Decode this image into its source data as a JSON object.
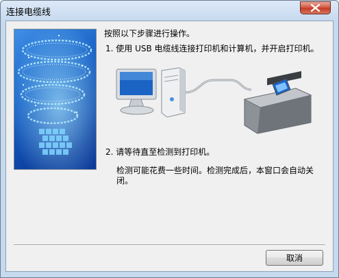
{
  "window": {
    "title": "连接电缆线"
  },
  "instructions": {
    "intro": "按照以下步骤进行操作。",
    "step1": "1. 使用 USB 电缆线连接打印机和计算机，并开启打印机。",
    "step2": "2. 请等待直至检测到打印机。",
    "note_line1": "检测可能花费一些时间。检测完成后，本窗口会自动关",
    "note_line2": "闭。"
  },
  "buttons": {
    "cancel": "取消"
  },
  "icons": {
    "close": "close-icon",
    "computer": "computer-icon",
    "printer": "printer-icon",
    "cable": "usb-cable-icon"
  },
  "colors": {
    "art_blue": "#1d6fd0",
    "close_red": "#c8432b"
  }
}
